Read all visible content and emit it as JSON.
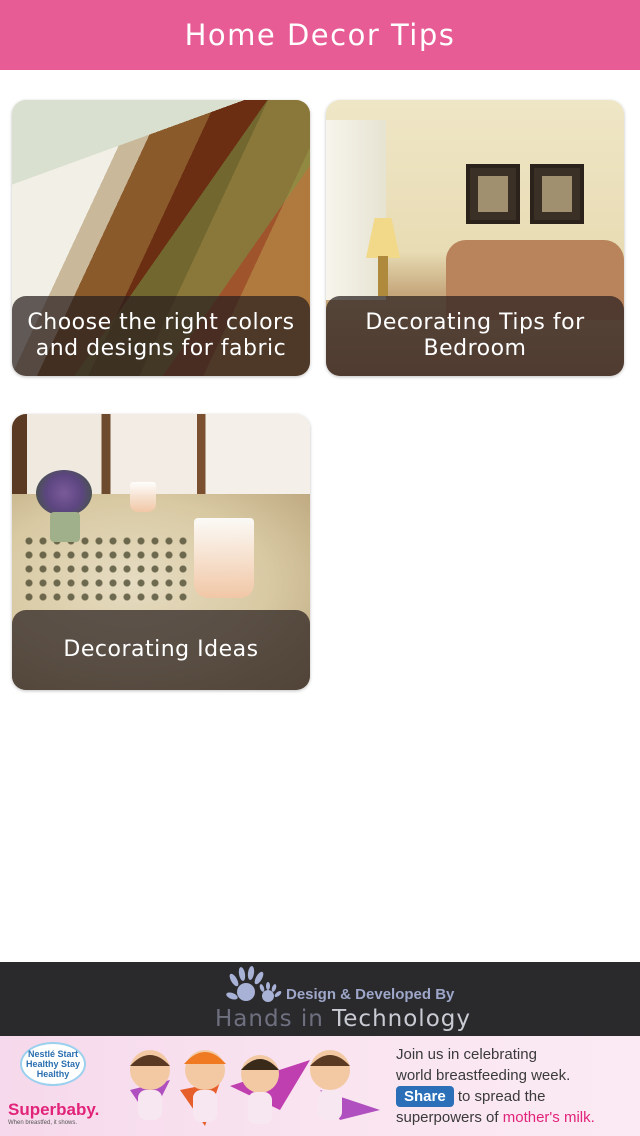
{
  "app": {
    "title": "Home Decor Tips"
  },
  "colors": {
    "header": "#e85c96",
    "footer": "#2a2a2d",
    "caption_overlay": "#281e1e"
  },
  "cards": [
    {
      "caption": "Choose the right colors and designs for fabric",
      "image": "room-chair-photo"
    },
    {
      "caption": "Decorating Tips for Bedroom",
      "image": "bedroom-lamp-photo"
    },
    {
      "caption": "Decorating Ideas",
      "image": "dining-table-photo"
    }
  ],
  "footer": {
    "label": "Design & Developed By",
    "brand_part1": "Hands in",
    "brand_part2": " Technology",
    "logo_icon": "hands-logo-icon"
  },
  "ad": {
    "logo_text": "Nestlé Start Healthy Stay Healthy",
    "brand": "Superbaby.",
    "tagline": "When breastfed, it shows.",
    "line1": "Join us in celebrating",
    "line2": "world breastfeeding week.",
    "share_label": "Share",
    "line3": " to spread the",
    "line4_part1": "superpowers of ",
    "line4_part2": "mother's milk."
  }
}
